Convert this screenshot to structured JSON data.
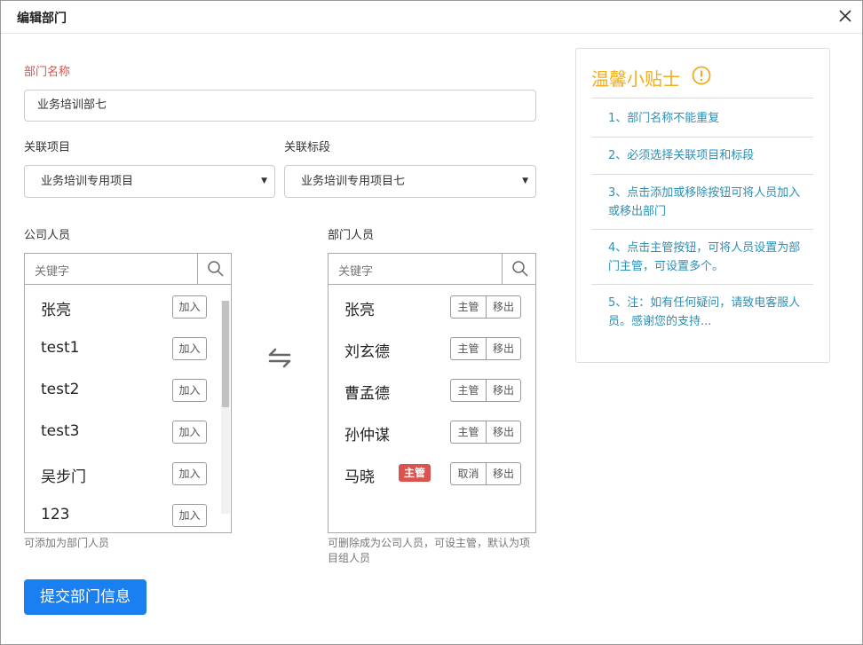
{
  "dialog": {
    "title": "编辑部门"
  },
  "form": {
    "dept_name_label": "部门名称",
    "dept_name_value": "业务培训部七",
    "project_label": "关联项目",
    "project_value": "业务培训专用项目",
    "section_label": "关联标段",
    "section_value": "业务培训专用项目七"
  },
  "company_staff": {
    "label": "公司人员",
    "search_placeholder": "关键字",
    "hint": "可添加为部门人员",
    "add_label": "加入",
    "people": [
      "张亮",
      "test1",
      "test2",
      "test3",
      "吴步门",
      "123"
    ]
  },
  "dept_staff": {
    "label": "部门人员",
    "search_placeholder": "关键字",
    "hint_line1": "可删除成为公司人员，可设主管，默认为项",
    "hint_line2": "目组人员",
    "manager_label": "主管",
    "remove_label": "移出",
    "cancel_label": "取消",
    "badge_label": "主管",
    "people": [
      {
        "name": "张亮",
        "is_manager": false
      },
      {
        "name": "刘玄德",
        "is_manager": false
      },
      {
        "name": "曹孟德",
        "is_manager": false
      },
      {
        "name": "孙仲谋",
        "is_manager": false
      },
      {
        "name": "马晓",
        "is_manager": true
      }
    ]
  },
  "submit_label": "提交部门信息",
  "tips": {
    "title": "温馨小贴士",
    "items": [
      "1、部门名称不能重复",
      "2、必须选择关联项目和标段",
      "3、点击添加或移除按钮可将人员加入或移出部门",
      "4、点击主管按钮，可将人员设置为部门主管，可设置多个。",
      "5、注：如有任何疑问，请致电客服人员。感谢您的支持..."
    ]
  },
  "colors": {
    "accent": "#1a7ff0",
    "required_label": "#d9534f",
    "tips_title": "#f0ad1f",
    "tips_text": "#2c8fb5",
    "manager_badge": "#d9534f"
  }
}
